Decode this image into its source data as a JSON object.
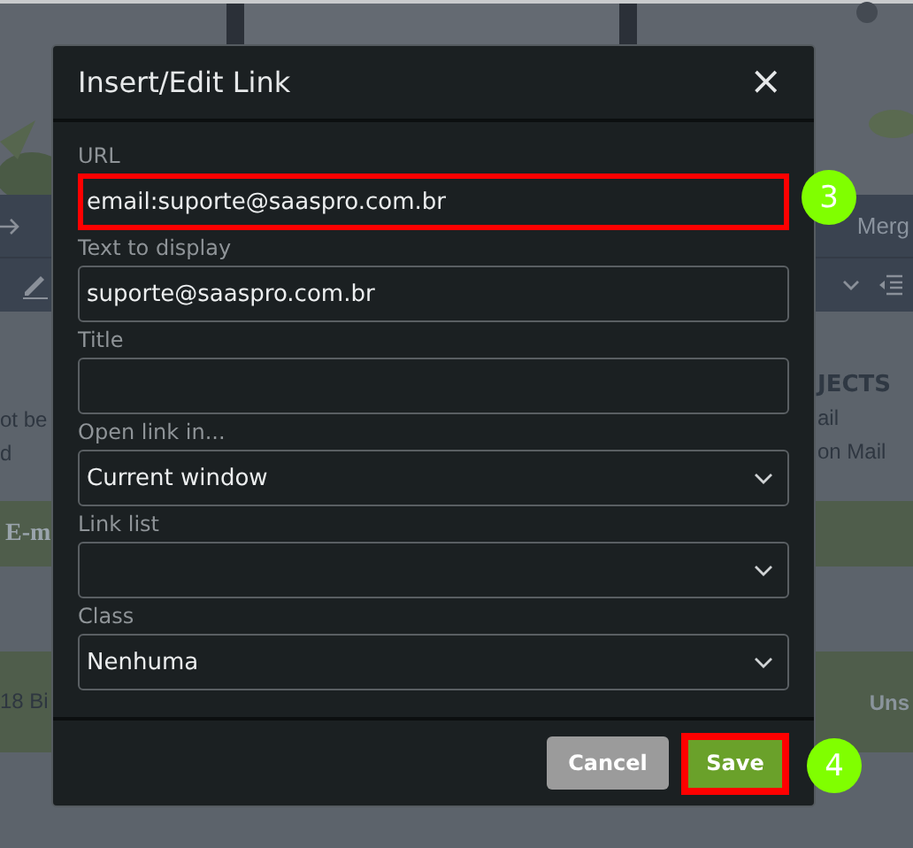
{
  "background": {
    "toolbar_tab": "Merg",
    "left_text": [
      "ot be",
      "d"
    ],
    "right_heading": "JECTS",
    "right_lines": [
      "ail",
      "on Mail"
    ],
    "banner_text": "E-m",
    "footer_left": "18 Bi",
    "footer_right": "Uns"
  },
  "dialog": {
    "title": "Insert/Edit Link",
    "close": "×",
    "fields": [
      {
        "kind": "text",
        "label": "URL",
        "value": "email:suporte@saaspro.com.br",
        "highlighted": true
      },
      {
        "kind": "text",
        "label": "Text to display",
        "value": "suporte@saaspro.com.br",
        "highlighted": false
      },
      {
        "kind": "text",
        "label": "Title",
        "highlighted": false
      },
      {
        "kind": "select",
        "label": "Open link in...",
        "value": "Current window",
        "highlighted": false
      },
      {
        "kind": "select",
        "label": "Link list",
        "highlighted": false
      },
      {
        "kind": "select",
        "label": "Class",
        "value": "Nenhuma",
        "highlighted": false
      }
    ],
    "buttons": [
      {
        "kind": "secondary",
        "label": "Cancel",
        "highlighted": false
      },
      {
        "kind": "primary",
        "label": "Save",
        "highlighted": true
      }
    ]
  },
  "callouts": [
    "3",
    "4"
  ]
}
